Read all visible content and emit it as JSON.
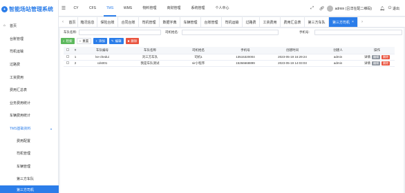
{
  "app": {
    "title": "智能场站管理系统"
  },
  "sidebar": {
    "home": "首页",
    "items": [
      {
        "label": "台账管理"
      },
      {
        "label": "司机运输"
      },
      {
        "label": "过路费"
      },
      {
        "label": "工资费用"
      },
      {
        "label": "费用汇总表"
      },
      {
        "label": "业务费用统计"
      },
      {
        "label": "车辆费用统计"
      },
      {
        "label": "TMS基础资料",
        "caret": "▴"
      },
      {
        "label": "费用配置"
      },
      {
        "label": "司机管理"
      },
      {
        "label": "车辆管理"
      },
      {
        "label": "第三方车队"
      },
      {
        "label": "第三方司机"
      }
    ]
  },
  "topnav": {
    "items": [
      "CY",
      "CFS",
      "TMS",
      "WMS",
      "物料管理",
      "商财管理",
      "系统管理",
      "个人中心"
    ],
    "user": "admin (吕洋在配二维码)",
    "logout": "退出"
  },
  "tabs": {
    "items": [
      "首页",
      "箱况信息",
      "保险台账",
      "合同台账",
      "司机管理",
      "数据字典",
      "车辆管理",
      "台账管理",
      "司机运输",
      "过路费",
      "工资费用",
      "费用汇总表",
      "第三方车队",
      "第三方司机"
    ],
    "close": "×"
  },
  "filters": {
    "car_no": "车队名称:",
    "driver": "司机姓名:",
    "phone": "手机号:"
  },
  "toolbar": {
    "search": "检索",
    "reset": "重置",
    "add": "添加",
    "edit": "编辑",
    "delete": "删除"
  },
  "table": {
    "columns": [
      "#",
      "车队编号",
      "车队名称",
      "司机姓名",
      "手机号",
      "创建时间",
      "创建人",
      "操作"
    ],
    "rows": [
      {
        "idx": "1",
        "code": "ke-chedui",
        "name": "刘三方车队",
        "driver": "司机1",
        "phone": "13515320004",
        "time": "2023-05-19 16:29:24",
        "creator": "admin"
      },
      {
        "idx": "2",
        "code": "cds001",
        "name": "我是车队测试",
        "driver": "sir小程序",
        "phone": "15266668899",
        "time": "2023-05-19 14:03:03",
        "creator": "admin"
      }
    ],
    "op_detail": "详情",
    "op_edit": "编辑",
    "op_delete": "删除"
  }
}
